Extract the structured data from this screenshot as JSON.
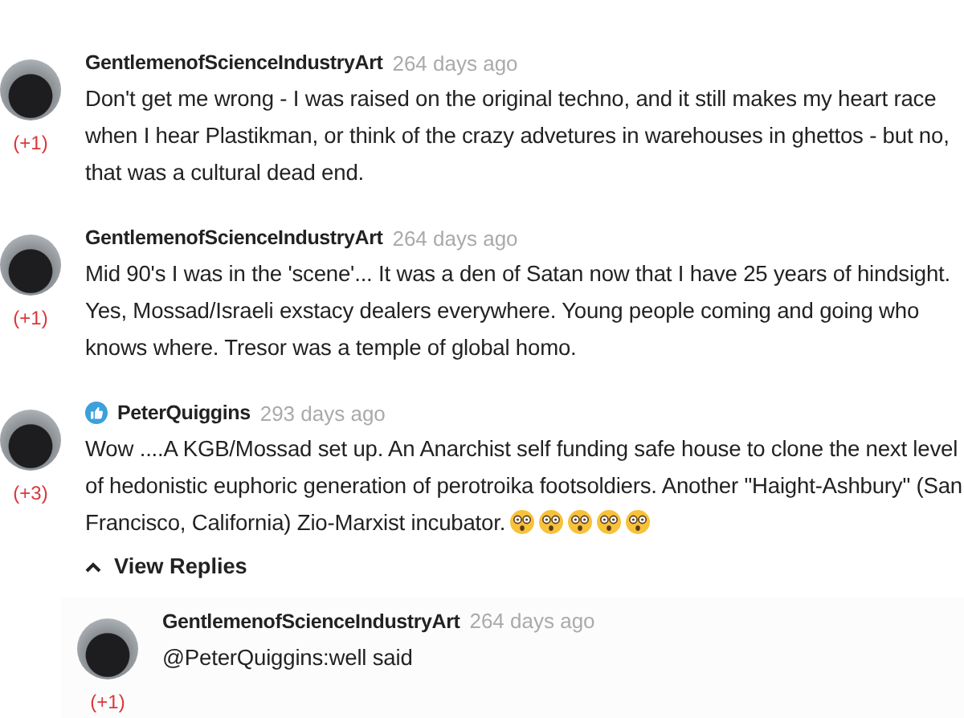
{
  "comments": [
    {
      "author": "GentlemenofScienceIndustryArt",
      "verified": false,
      "time": "264 days ago",
      "score": "(+1)",
      "text": "Don't get me wrong - I was raised on the original techno, and it still makes my heart race when I hear Plastikman, or think of the crazy advetures in warehouses in ghettos - but no, that was a cultural dead end."
    },
    {
      "author": "GentlemenofScienceIndustryArt",
      "verified": false,
      "time": "264 days ago",
      "score": "(+1)",
      "text": "Mid 90's I was in the 'scene'... It was a den of Satan now that I have 25 years of hindsight. Yes, Mossad/Israeli exstacy dealers everywhere. Young people coming and going who knows where. Tresor was a temple of global homo."
    },
    {
      "author": "PeterQuiggins",
      "verified": true,
      "time": "293 days ago",
      "score": "(+3)",
      "text": "Wow ....A KGB/Mossad set up. An Anarchist self funding safe house to clone the next level of hedonistic euphoric generation of perotroika footsoldiers. Another \"Haight-Ashbury\" (San Francisco, California) Zio-Marxist incubator.",
      "emojis": [
        {
          "kind": "dizzy-face"
        },
        {
          "kind": "dizzy-face"
        },
        {
          "kind": "dizzy-face"
        },
        {
          "kind": "dizzy-face"
        },
        {
          "kind": "dizzy-face"
        }
      ],
      "view_replies": {
        "label": "View Replies",
        "expanded": true
      },
      "replies": [
        {
          "author": "GentlemenofScienceIndustryArt",
          "verified": false,
          "time": "264 days ago",
          "score": "(+1)",
          "text": "@PeterQuiggins:well said"
        }
      ]
    }
  ]
}
